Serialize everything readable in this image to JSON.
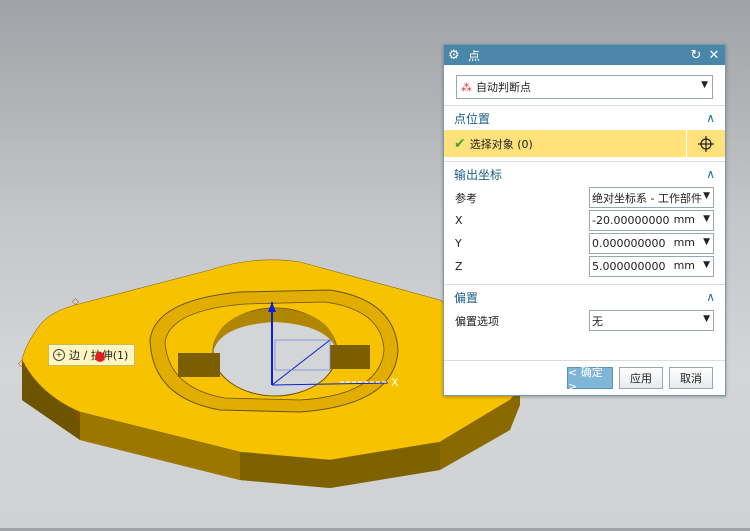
{
  "dialog": {
    "title": "点",
    "type_select": "自动判断点",
    "sections": {
      "point_location": {
        "header": "点位置",
        "select_object": "选择对象 (0)"
      },
      "output_coords": {
        "header": "输出坐标",
        "reference_label": "参考",
        "reference_value": "绝对坐标系 - 工作部件",
        "x_label": "X",
        "x_value": "-20.00000000",
        "y_label": "Y",
        "y_value": "0.000000000",
        "z_label": "Z",
        "z_value": "5.000000000",
        "unit": "mm"
      },
      "offset": {
        "header": "偏置",
        "option_label": "偏置选项",
        "option_value": "无"
      }
    },
    "buttons": {
      "ok": "< 确定 >",
      "apply": "应用",
      "cancel": "取消"
    }
  },
  "viewport": {
    "tooltip": "边 / 拉伸(1)",
    "axis_label": "X",
    "part_color": "#f7c300"
  }
}
